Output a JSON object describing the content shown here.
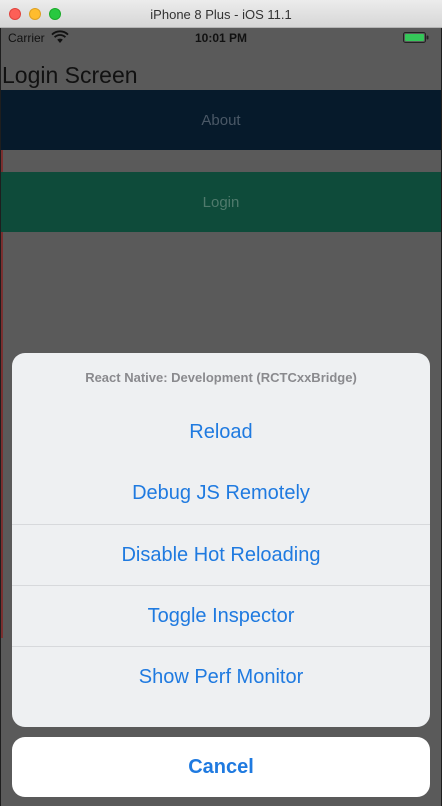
{
  "window": {
    "title": "iPhone 8 Plus - iOS 11.1"
  },
  "status_bar": {
    "carrier": "Carrier",
    "time": "10:01 PM",
    "battery_color": "#35c759"
  },
  "app": {
    "title": "Login Screen",
    "about_label": "About",
    "login_label": "Login"
  },
  "dev_menu": {
    "header": "React Native: Development (RCTCxxBridge)",
    "items": [
      {
        "label": "Reload"
      },
      {
        "label": "Debug JS Remotely"
      },
      {
        "label": "Disable Hot Reloading"
      },
      {
        "label": "Toggle Inspector"
      },
      {
        "label": "Show Perf Monitor"
      }
    ],
    "cancel_label": "Cancel",
    "accent_color": "#1f7ae0"
  }
}
